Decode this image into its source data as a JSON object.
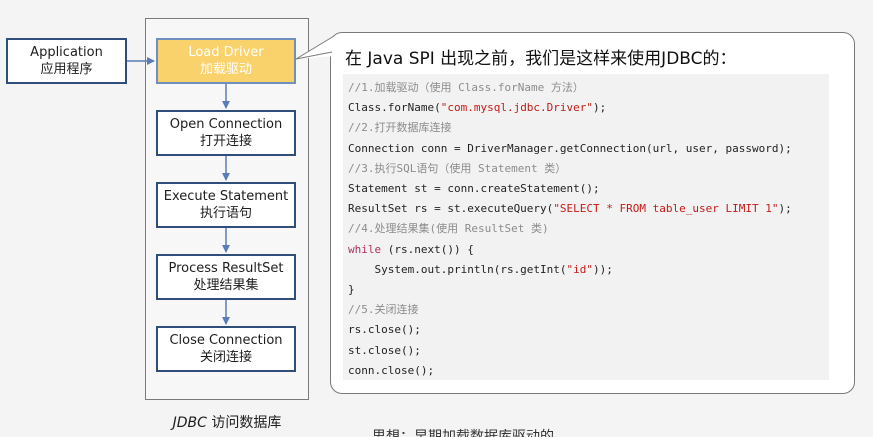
{
  "application": {
    "en": "Application",
    "zh": "应用程序"
  },
  "steps": [
    {
      "en": "Load Driver",
      "zh": "加载驱动",
      "active": true
    },
    {
      "en": "Open Connection",
      "zh": "打开连接",
      "active": false
    },
    {
      "en": "Execute Statement",
      "zh": "执行语句",
      "active": false
    },
    {
      "en": "Process ResultSet",
      "zh": "处理结果集",
      "active": false
    },
    {
      "en": "Close Connection",
      "zh": "关闭连接",
      "active": false
    }
  ],
  "group_caption": {
    "en": "JDBC",
    "zh": "访问数据库"
  },
  "callout": {
    "title": "在 Java SPI 出现之前，我们是这样来使用JDBC的：",
    "code": [
      {
        "type": "comment",
        "text": "//1.加载驱动（使用 Class.forName 方法）"
      },
      {
        "type": "code",
        "pre": "Class.forName(",
        "str": "\"com.mysql.jdbc.Driver\"",
        "post": ");"
      },
      {
        "type": "comment",
        "text": "//2.打开数据库连接"
      },
      {
        "type": "code",
        "pre": "Connection conn = DriverManager.getConnection(url, user, password);",
        "str": "",
        "post": ""
      },
      {
        "type": "comment",
        "text": "//3.执行SQL语句（使用 Statement 类）"
      },
      {
        "type": "code",
        "pre": "Statement st = conn.createStatement();",
        "str": "",
        "post": ""
      },
      {
        "type": "code",
        "pre": "ResultSet rs = st.executeQuery(",
        "str": "\"SELECT * FROM table_user LIMIT 1\"",
        "post": ");"
      },
      {
        "type": "comment",
        "text": "//4.处理结果集(使用 ResultSet 类)"
      },
      {
        "type": "kw",
        "kw": "while",
        "pre": " (rs.next()) {",
        "str": "",
        "post": ""
      },
      {
        "type": "code",
        "pre": "    System.out.println(rs.getInt(",
        "str": "\"id\"",
        "post": "));"
      },
      {
        "type": "code",
        "pre": "}",
        "str": "",
        "post": ""
      },
      {
        "type": "comment",
        "text": "//5.关闭连接"
      },
      {
        "type": "code",
        "pre": "rs.close();",
        "str": "",
        "post": ""
      },
      {
        "type": "code",
        "pre": "st.close();",
        "str": "",
        "post": ""
      },
      {
        "type": "code",
        "pre": "conn.close();",
        "str": "",
        "post": ""
      }
    ]
  },
  "bottom_text": "思想：早期加载数据库驱动的"
}
